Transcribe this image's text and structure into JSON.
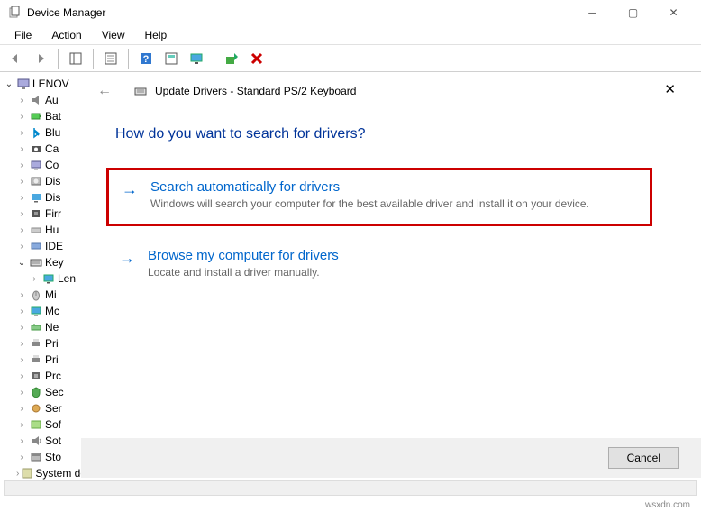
{
  "window": {
    "title": "Device Manager"
  },
  "menu": {
    "file": "File",
    "action": "Action",
    "view": "View",
    "help": "Help"
  },
  "tree": {
    "root": "LENOV",
    "items": [
      {
        "label": "Au",
        "icon": "speaker"
      },
      {
        "label": "Bat",
        "icon": "battery"
      },
      {
        "label": "Blu",
        "icon": "bt"
      },
      {
        "label": "Ca",
        "icon": "camera"
      },
      {
        "label": "Co",
        "icon": "computer"
      },
      {
        "label": "Dis",
        "icon": "disk"
      },
      {
        "label": "Dis",
        "icon": "display"
      },
      {
        "label": "Firr",
        "icon": "chip"
      },
      {
        "label": "Hu",
        "icon": "hid"
      },
      {
        "label": "IDE",
        "icon": "ide"
      },
      {
        "label": "Key",
        "icon": "keyboard",
        "expanded": true
      },
      {
        "label": "Len",
        "icon": "monitor",
        "child": true
      },
      {
        "label": "Mi",
        "icon": "mouse"
      },
      {
        "label": "Mc",
        "icon": "monitor"
      },
      {
        "label": "Ne",
        "icon": "network"
      },
      {
        "label": "Pri",
        "icon": "printer"
      },
      {
        "label": "Pri",
        "icon": "printer"
      },
      {
        "label": "Prc",
        "icon": "processor"
      },
      {
        "label": "Sec",
        "icon": "security"
      },
      {
        "label": "Ser",
        "icon": "sensor"
      },
      {
        "label": "Sof",
        "icon": "software"
      },
      {
        "label": "Sot",
        "icon": "sound"
      },
      {
        "label": "Sto",
        "icon": "storage"
      }
    ],
    "last": "System devices"
  },
  "dialog": {
    "back_icon": "←",
    "title": "Update Drivers - Standard PS/2 Keyboard",
    "question": "How do you want to search for drivers?",
    "opt1": {
      "title": "Search automatically for drivers",
      "desc": "Windows will search your computer for the best available driver and install it on your device."
    },
    "opt2": {
      "title": "Browse my computer for drivers",
      "desc": "Locate and install a driver manually."
    },
    "cancel": "Cancel"
  },
  "footer": "wsxdn.com"
}
